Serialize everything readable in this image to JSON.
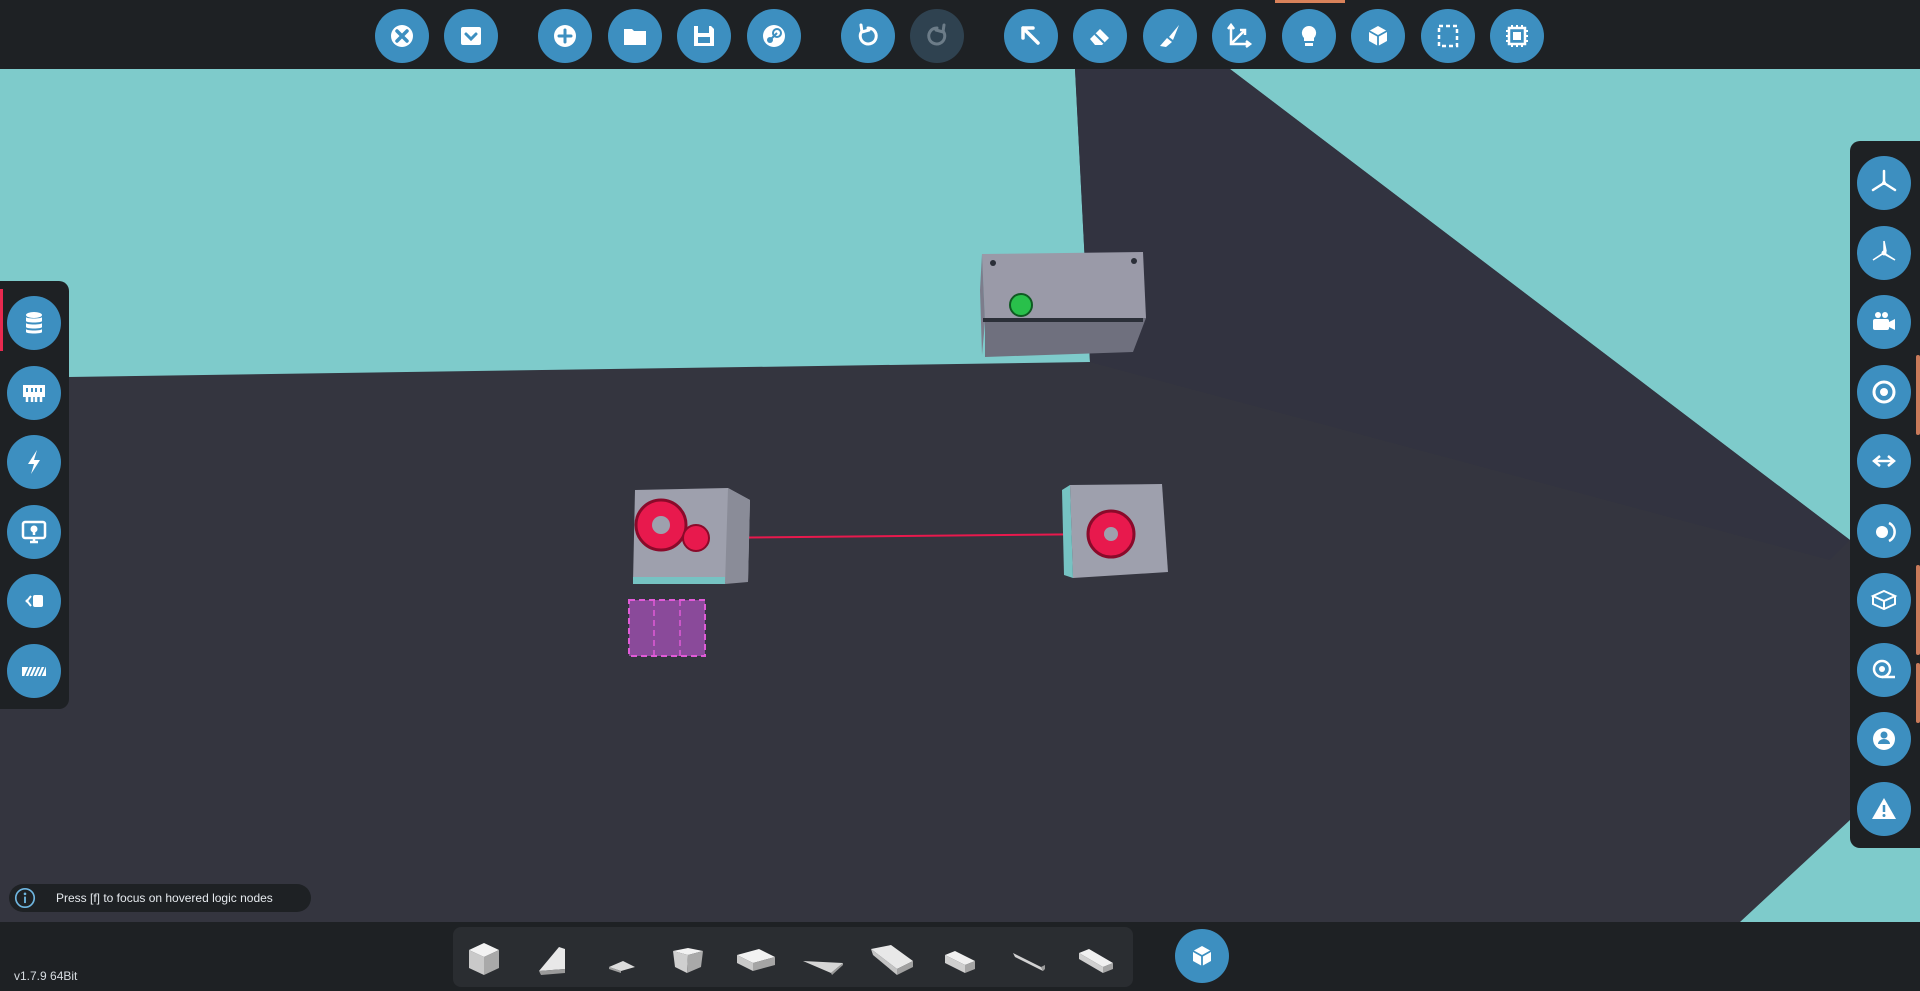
{
  "app": {
    "version": "v1.7.9 64Bit"
  },
  "hint": {
    "text": "Press [f] to focus on hovered logic nodes",
    "icon": "info-icon"
  },
  "top_toolbar": {
    "groups": [
      [
        "close-icon",
        "collapse-icon"
      ],
      [
        "add-circle-icon",
        "folder-icon",
        "save-icon",
        "steam-icon"
      ],
      [
        "undo-icon",
        "redo-icon"
      ],
      [
        "select-cursor-icon",
        "eraser-icon",
        "paint-brush-icon",
        "move-axes-icon",
        "light-bulb-icon",
        "logic-blocks-icon",
        "selection-box-icon",
        "chip-icon"
      ]
    ],
    "redo_enabled": false,
    "active_tool": "light-bulb-icon"
  },
  "left_panel": {
    "items": [
      "database-icon",
      "keyboard-icon",
      "lightning-icon",
      "monitor-icon",
      "speaker-icon",
      "hatched-bar-icon"
    ],
    "active_item": "database-icon"
  },
  "right_panel": {
    "items": [
      "fan-icon",
      "fan-alt-icon",
      "camera-icon",
      "target-icon",
      "arrows-exchange-icon",
      "orbit-icon",
      "cube-outline-icon",
      "measuring-tape-icon",
      "person-circle-icon",
      "warning-icon"
    ]
  },
  "bottom_bar": {
    "blocks": [
      "cube-block",
      "wedge-block",
      "flat-wedge-block",
      "half-cube-block",
      "wide-slab-block",
      "thin-wedge-block",
      "large-slab-block",
      "small-slab-block",
      "thin-sliver-block",
      "long-slab-block"
    ],
    "mode_button_icon": "logic-blocks-icon"
  },
  "colors": {
    "sky": "#7ecbcb",
    "ground": "#34353f",
    "panel": "#1e2124",
    "button": "#3d8fc0",
    "logic_node": "#e8194d",
    "active_node": "#29c04b",
    "selection": "#b455c8"
  }
}
